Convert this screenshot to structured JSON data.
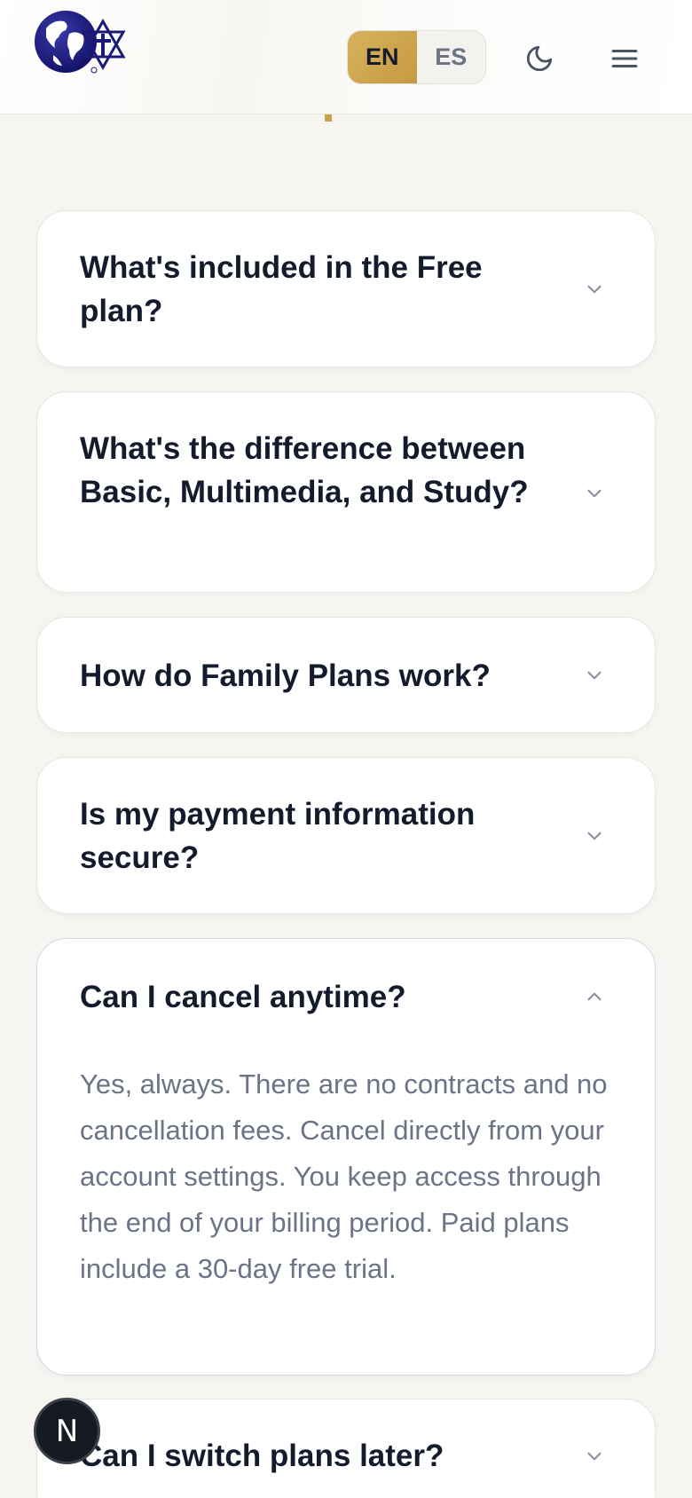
{
  "header": {
    "logo_icon": "globe-star-cross-logo",
    "languages": [
      {
        "code": "EN",
        "active": true
      },
      {
        "code": "ES",
        "active": false
      }
    ],
    "theme_icon": "moon-icon",
    "menu_icon": "hamburger-menu-icon"
  },
  "faq": [
    {
      "question": "What's included in the Free plan?",
      "open": false
    },
    {
      "question": "What's the difference between Basic, Multimedia, and Study?",
      "open": false
    },
    {
      "question": "How do Family Plans work?",
      "open": false
    },
    {
      "question": "Is my payment information secure?",
      "open": false
    },
    {
      "question": "Can I cancel anytime?",
      "open": true,
      "answer": "Yes, always. There are no contracts and no cancellation fees. Cancel directly from your account settings. You keep access through the end of your billing period. Paid plans include a 30-day free trial."
    },
    {
      "question": "Can I switch plans later?",
      "open": false
    }
  ],
  "fab": {
    "label": "N"
  },
  "colors": {
    "accent_gold": "#c9a14e",
    "text_dark": "#141b2d",
    "text_muted": "#6b7487",
    "background": "#f6f5f1",
    "logo_navy": "#1b1a78"
  }
}
